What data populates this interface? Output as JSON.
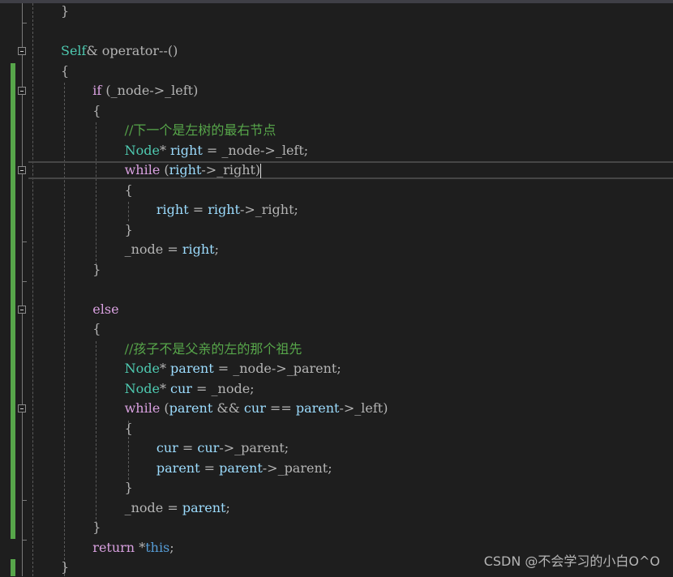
{
  "editor": {
    "lines": [
      {
        "indent": 0,
        "tokens": [
          {
            "t": "}",
            "c": "op"
          }
        ]
      },
      {
        "indent": 0,
        "tokens": []
      },
      {
        "indent": 0,
        "tokens": [
          {
            "t": "Self",
            "c": "type"
          },
          {
            "t": "& operator--()",
            "c": "op"
          }
        ]
      },
      {
        "indent": 0,
        "tokens": [
          {
            "t": "{",
            "c": "op"
          }
        ]
      },
      {
        "indent": 1,
        "tokens": [
          {
            "t": "if",
            "c": "kw"
          },
          {
            "t": " (_node->_left)",
            "c": "op"
          }
        ]
      },
      {
        "indent": 1,
        "tokens": [
          {
            "t": "{",
            "c": "op"
          }
        ]
      },
      {
        "indent": 2,
        "tokens": [
          {
            "t": "//下一个是左树的最右节点",
            "c": "cm"
          }
        ]
      },
      {
        "indent": 2,
        "tokens": [
          {
            "t": "Node",
            "c": "type"
          },
          {
            "t": "* ",
            "c": "op"
          },
          {
            "t": "right",
            "c": "var"
          },
          {
            "t": " = _node->_left;",
            "c": "op"
          }
        ]
      },
      {
        "indent": 2,
        "tokens": [
          {
            "t": "while",
            "c": "kw"
          },
          {
            "t": " (",
            "c": "op"
          },
          {
            "t": "right",
            "c": "var"
          },
          {
            "t": "->_right)",
            "c": "op"
          }
        ],
        "caret": true
      },
      {
        "indent": 2,
        "tokens": [
          {
            "t": "{",
            "c": "op"
          }
        ]
      },
      {
        "indent": 3,
        "tokens": [
          {
            "t": "right",
            "c": "var"
          },
          {
            "t": " = ",
            "c": "op"
          },
          {
            "t": "right",
            "c": "var"
          },
          {
            "t": "->_right;",
            "c": "op"
          }
        ]
      },
      {
        "indent": 2,
        "tokens": [
          {
            "t": "}",
            "c": "op"
          }
        ]
      },
      {
        "indent": 2,
        "tokens": [
          {
            "t": "_node = ",
            "c": "op"
          },
          {
            "t": "right",
            "c": "var"
          },
          {
            "t": ";",
            "c": "op"
          }
        ]
      },
      {
        "indent": 1,
        "tokens": [
          {
            "t": "}",
            "c": "op"
          }
        ]
      },
      {
        "indent": 1,
        "tokens": []
      },
      {
        "indent": 1,
        "tokens": [
          {
            "t": "else",
            "c": "kw"
          }
        ]
      },
      {
        "indent": 1,
        "tokens": [
          {
            "t": "{",
            "c": "op"
          }
        ]
      },
      {
        "indent": 2,
        "tokens": [
          {
            "t": "//孩子不是父亲的左的那个祖先",
            "c": "cm"
          }
        ]
      },
      {
        "indent": 2,
        "tokens": [
          {
            "t": "Node",
            "c": "type"
          },
          {
            "t": "* ",
            "c": "op"
          },
          {
            "t": "parent",
            "c": "var"
          },
          {
            "t": " = _node->_parent;",
            "c": "op"
          }
        ]
      },
      {
        "indent": 2,
        "tokens": [
          {
            "t": "Node",
            "c": "type"
          },
          {
            "t": "* ",
            "c": "op"
          },
          {
            "t": "cur",
            "c": "var"
          },
          {
            "t": " = _node;",
            "c": "op"
          }
        ]
      },
      {
        "indent": 2,
        "tokens": [
          {
            "t": "while",
            "c": "kw"
          },
          {
            "t": " (",
            "c": "op"
          },
          {
            "t": "parent",
            "c": "var"
          },
          {
            "t": " && ",
            "c": "op"
          },
          {
            "t": "cur",
            "c": "var"
          },
          {
            "t": " == ",
            "c": "op"
          },
          {
            "t": "parent",
            "c": "var"
          },
          {
            "t": "->_left)",
            "c": "op"
          }
        ]
      },
      {
        "indent": 2,
        "tokens": [
          {
            "t": "{",
            "c": "op"
          }
        ]
      },
      {
        "indent": 3,
        "tokens": [
          {
            "t": "cur",
            "c": "var"
          },
          {
            "t": " = ",
            "c": "op"
          },
          {
            "t": "cur",
            "c": "var"
          },
          {
            "t": "->_parent;",
            "c": "op"
          }
        ]
      },
      {
        "indent": 3,
        "tokens": [
          {
            "t": "parent",
            "c": "var"
          },
          {
            "t": " = ",
            "c": "op"
          },
          {
            "t": "parent",
            "c": "var"
          },
          {
            "t": "->_parent;",
            "c": "op"
          }
        ]
      },
      {
        "indent": 2,
        "tokens": [
          {
            "t": "}",
            "c": "op"
          }
        ]
      },
      {
        "indent": 2,
        "tokens": [
          {
            "t": "_node = ",
            "c": "op"
          },
          {
            "t": "parent",
            "c": "var"
          },
          {
            "t": ";",
            "c": "op"
          }
        ]
      },
      {
        "indent": 1,
        "tokens": [
          {
            "t": "}",
            "c": "op"
          }
        ]
      },
      {
        "indent": 1,
        "tokens": [
          {
            "t": "return",
            "c": "kw"
          },
          {
            "t": " *",
            "c": "op"
          },
          {
            "t": "this",
            "c": "this"
          },
          {
            "t": ";",
            "c": "op"
          }
        ]
      },
      {
        "indent": 0,
        "tokens": [
          {
            "t": "}",
            "c": "op"
          }
        ]
      }
    ],
    "current_line": 8,
    "fold_lines": [
      2,
      4,
      8,
      15,
      20
    ]
  },
  "colors": {
    "background": "#1e1e1e",
    "keyword": "#d8a0df",
    "type": "#4ec9b0",
    "variable": "#9cdcfe",
    "comment": "#57a64a",
    "change_bar": "#57a64a"
  },
  "watermark": "CSDN @不会学习的小白O^O"
}
